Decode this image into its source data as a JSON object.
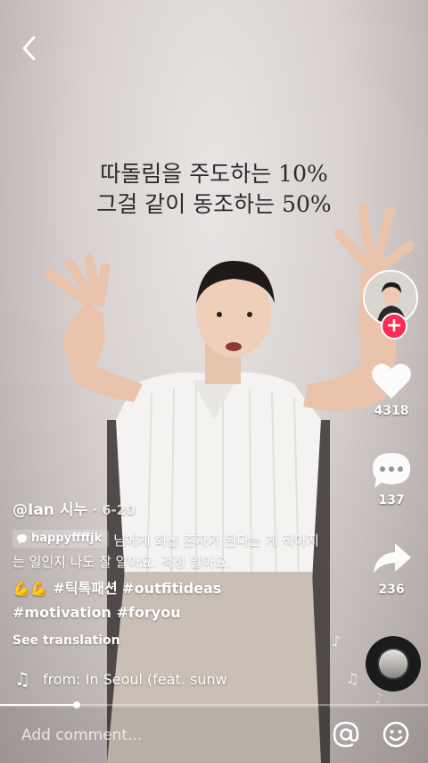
{
  "video": {
    "overlay_line1": "따돌림을 주도하는 10%",
    "overlay_line2": "그걸 같이 동조하는 50%"
  },
  "rail": {
    "likes": "4318",
    "comments": "137",
    "shares": "236"
  },
  "caption": {
    "username": "@Ian 시누",
    "date": "· 6-20",
    "reply_to": "happyffffjk",
    "reply_text": "님에게 회신 혼자가 된다는 게 작아지는 일인지 나도 잘 알아요. 걱정 말아요.",
    "emojis": "💪💪",
    "tags_line1": "#틱톡패션 #outfitideas",
    "tags_line2": "#motivation #foryou",
    "see_translation": "See translation"
  },
  "music": {
    "text": "from: In Seoul (feat. sunw"
  },
  "progress": {
    "fraction": 0.18
  },
  "comment": {
    "placeholder": "Add comment..."
  },
  "colors": {
    "accent": "#fe2c55"
  }
}
